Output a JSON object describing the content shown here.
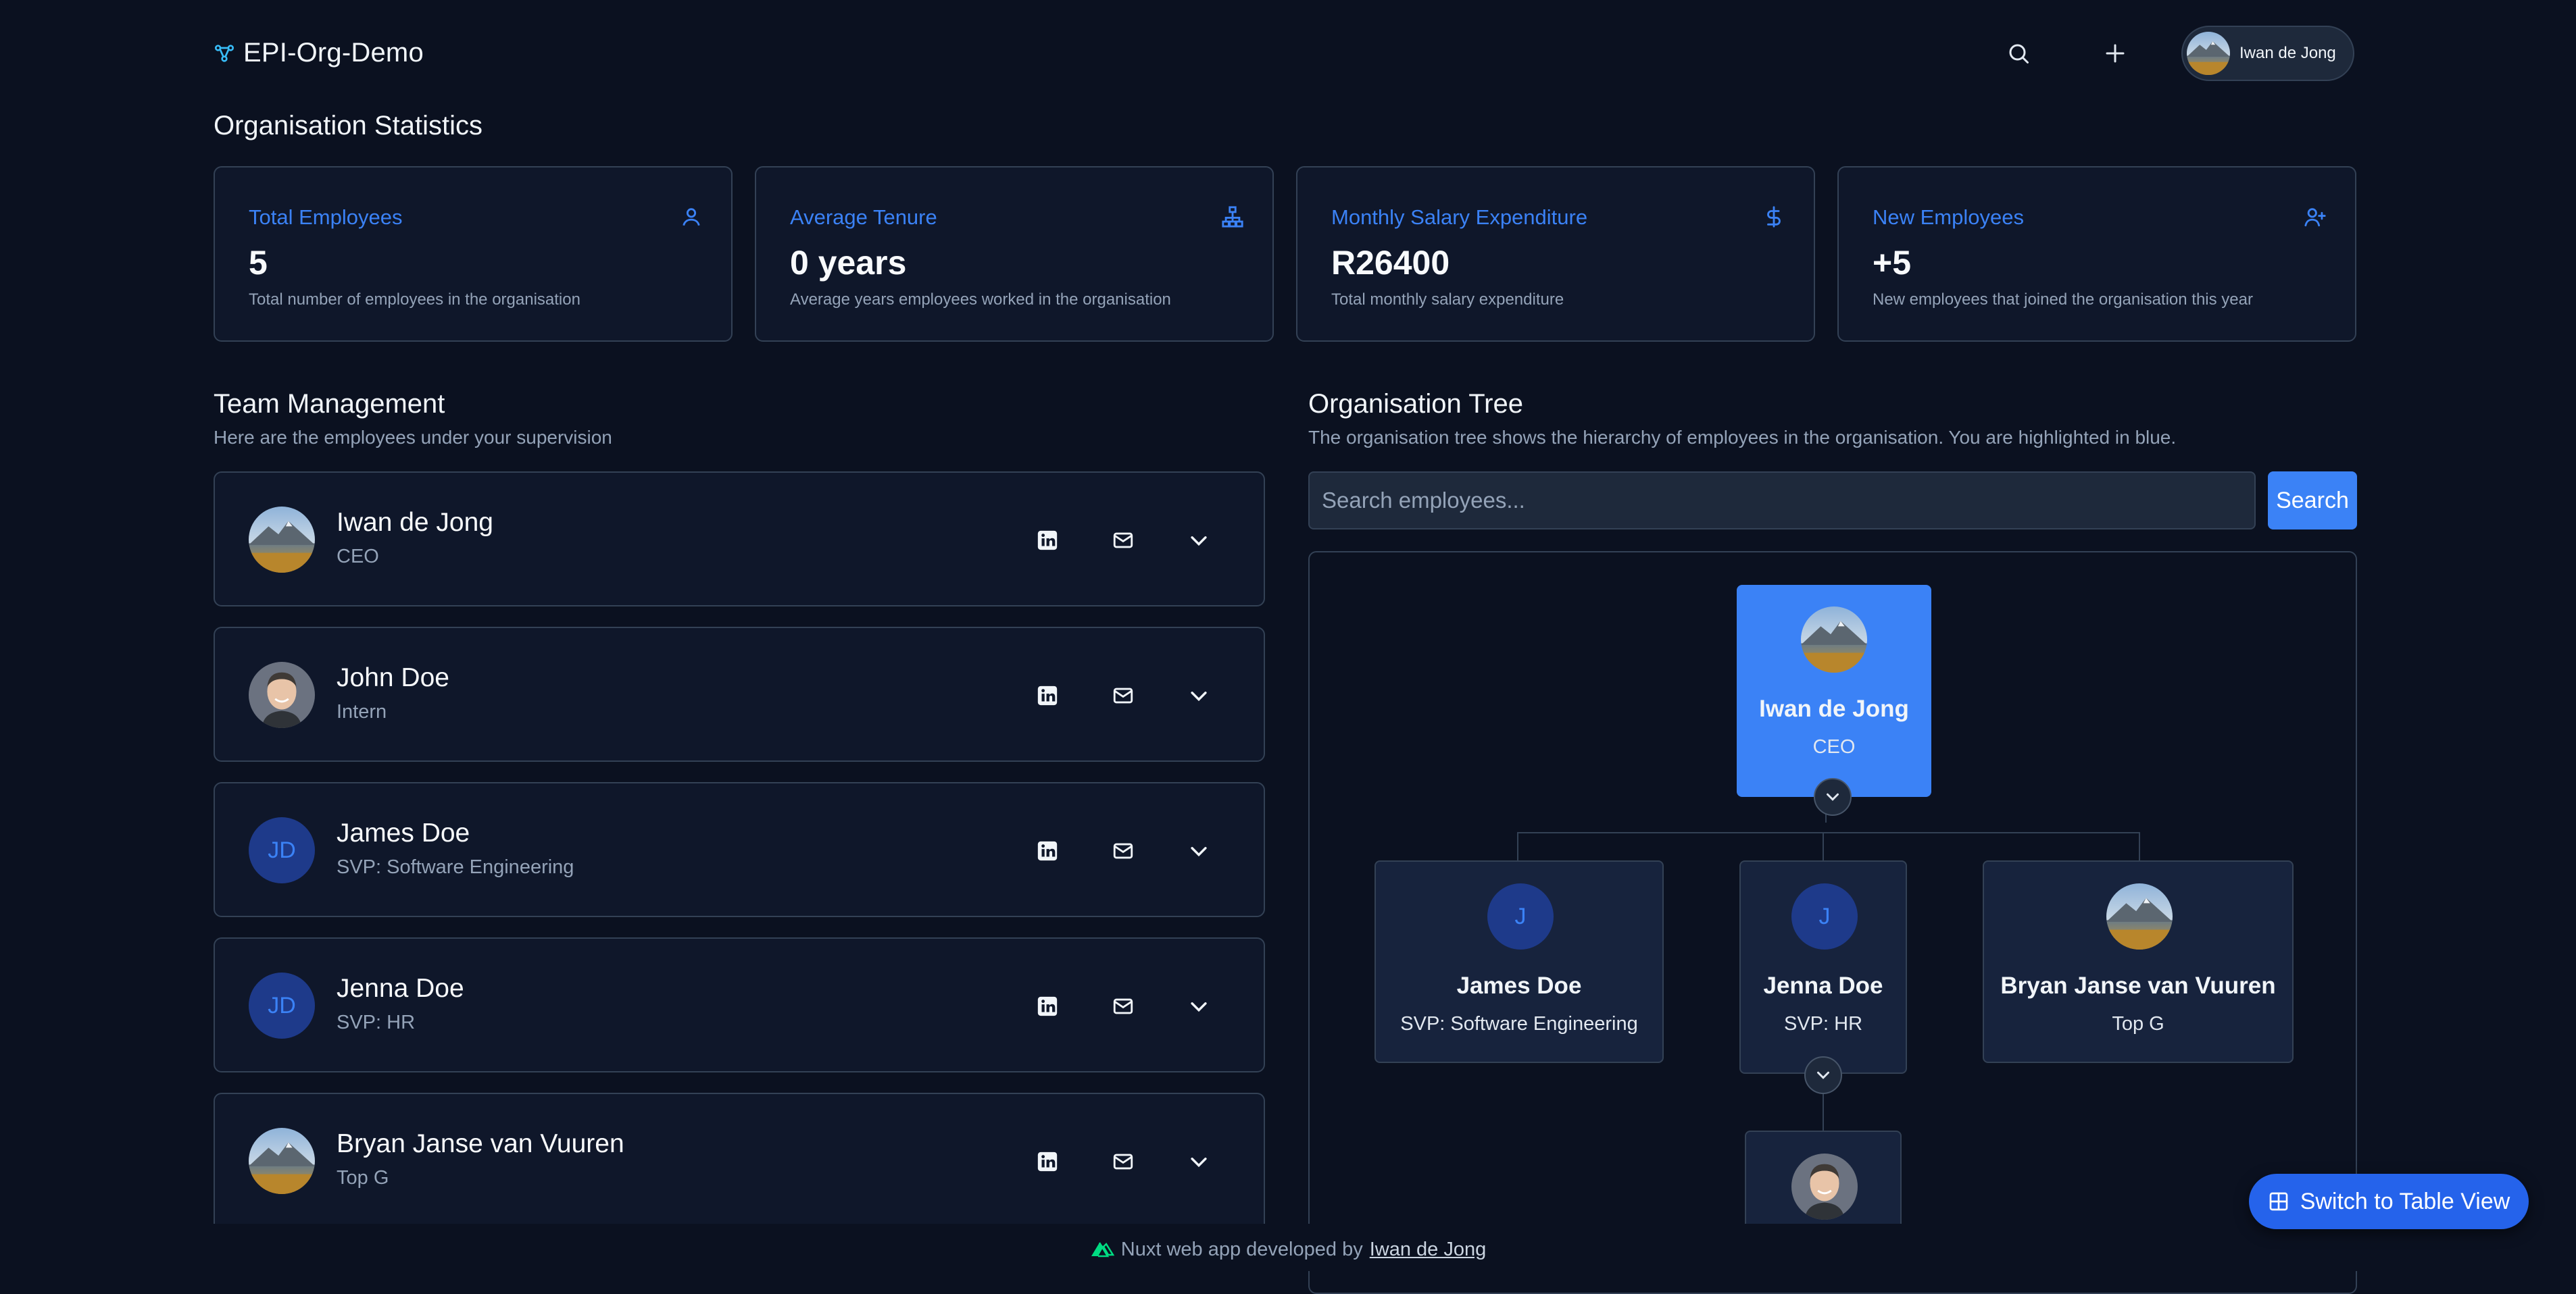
{
  "header": {
    "app_title": "EPI-Org-Demo",
    "user_name": "Iwan de Jong"
  },
  "stats": {
    "title": "Organisation Statistics",
    "cards": [
      {
        "label": "Total Employees",
        "value": "5",
        "desc": "Total number of employees in the organisation",
        "icon": "user-icon"
      },
      {
        "label": "Average Tenure",
        "value": "0 years",
        "desc": "Average years employees worked in the organisation",
        "icon": "org-chart-icon"
      },
      {
        "label": "Monthly Salary Expenditure",
        "value": "R26400",
        "desc": "Total monthly salary expenditure",
        "icon": "dollar-icon"
      },
      {
        "label": "New Employees",
        "value": "+5",
        "desc": "New employees that joined the organisation this year",
        "icon": "user-plus-icon"
      }
    ]
  },
  "team": {
    "title": "Team Management",
    "subtitle": "Here are the employees under your supervision",
    "members": [
      {
        "name": "Iwan de Jong",
        "role": "CEO",
        "avatar": "landscape"
      },
      {
        "name": "John Doe",
        "role": "Intern",
        "avatar": "person"
      },
      {
        "name": "James Doe",
        "role": "SVP: Software Engineering",
        "initials": "JD"
      },
      {
        "name": "Jenna Doe",
        "role": "SVP: HR",
        "initials": "JD"
      },
      {
        "name": "Bryan Janse van Vuuren",
        "role": "Top G",
        "avatar": "landscape"
      }
    ]
  },
  "tree": {
    "title": "Organisation Tree",
    "subtitle": "The organisation tree shows the hierarchy of employees in the organisation. You are highlighted in blue.",
    "search_placeholder": "Search employees...",
    "search_button": "Search",
    "root": {
      "name": "Iwan de Jong",
      "role": "CEO"
    },
    "children": [
      {
        "name": "James Doe",
        "role": "SVP: Software Engineering",
        "initial": "J"
      },
      {
        "name": "Jenna Doe",
        "role": "SVP: HR",
        "initial": "J"
      },
      {
        "name": "Bryan Janse van Vuuren",
        "role": "Top G"
      }
    ]
  },
  "switch_view_label": "Switch to Table View",
  "footer": {
    "text": "Nuxt web app developed by",
    "link": "Iwan de Jong"
  },
  "colors": {
    "background": "#0b1120",
    "accent": "#3b82f6",
    "card_border": "#334155"
  }
}
